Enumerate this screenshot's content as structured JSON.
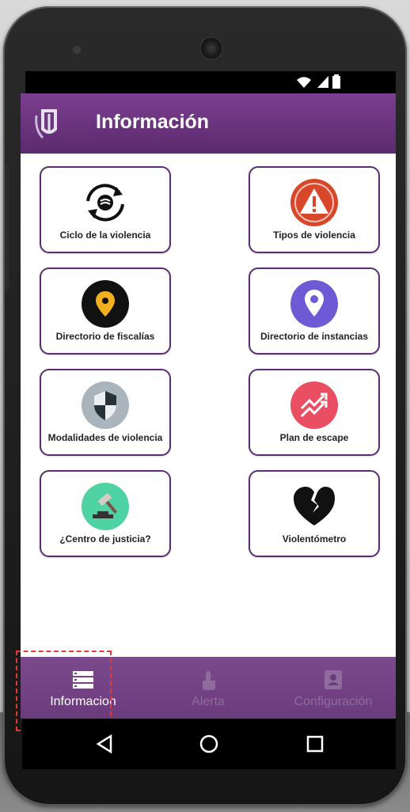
{
  "app": {
    "title": "Información"
  },
  "colors": {
    "primary": "#6b3a7e",
    "card_border": "#5b2c6f",
    "nav_active": "#ffffff",
    "nav_inactive": "#8f6b9e"
  },
  "cards": [
    {
      "label": "Ciclo de la violencia",
      "icon": "cycle-icon"
    },
    {
      "label": "Tipos de violencia",
      "icon": "warning-icon"
    },
    {
      "label": "Directorio de fiscalías",
      "icon": "location-pin-dark-icon"
    },
    {
      "label": "Directorio de instancias",
      "icon": "location-pin-purple-icon"
    },
    {
      "label": "Modalidades de violencia",
      "icon": "shield-icon"
    },
    {
      "label": "Plan de escape",
      "icon": "escape-arrows-icon"
    },
    {
      "label": "¿Centro de justicia?",
      "icon": "gavel-icon"
    },
    {
      "label": "Violentómetro",
      "icon": "broken-heart-icon"
    }
  ],
  "bottom_nav": [
    {
      "label": "Informacion",
      "icon": "list-icon",
      "active": true
    },
    {
      "label": "Alerta",
      "icon": "touch-icon",
      "active": false
    },
    {
      "label": "Configuración",
      "icon": "contact-card-icon",
      "active": false
    }
  ]
}
